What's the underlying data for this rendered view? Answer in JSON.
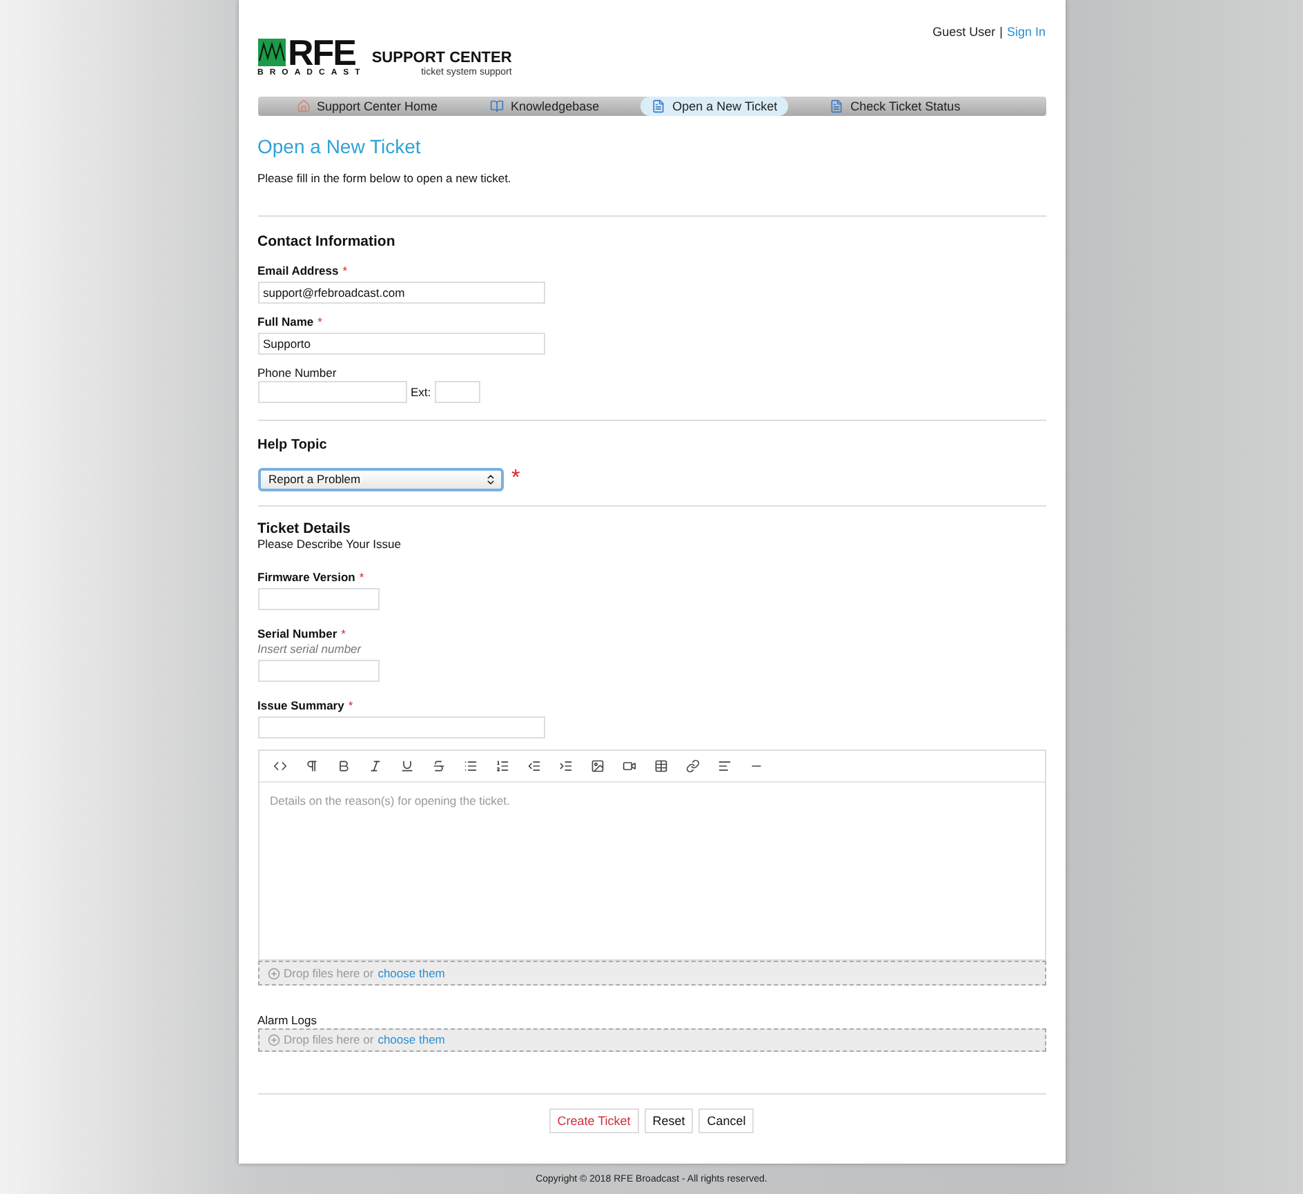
{
  "header": {
    "logo": {
      "letters": "RFE",
      "subline": "BROADCAST",
      "title": "SUPPORT CENTER",
      "tagline": "ticket system support"
    },
    "user": "Guest User",
    "separator": "|",
    "sign_in": "Sign In"
  },
  "nav": [
    {
      "label": "Support Center Home",
      "selected": false
    },
    {
      "label": "Knowledgebase",
      "selected": false
    },
    {
      "label": "Open a New Ticket",
      "selected": true
    },
    {
      "label": "Check Ticket Status",
      "selected": false
    }
  ],
  "page_title": "Open a New Ticket",
  "intro": "Please fill in the form below to open a new ticket.",
  "required_mark": "*",
  "contact": {
    "title": "Contact Information",
    "fields": [
      {
        "label": "Email Address",
        "required": true,
        "value": "support@rfebroadcast.com"
      },
      {
        "label": "Full Name",
        "required": true,
        "value": "Supporto"
      }
    ],
    "phone": {
      "label": "Phone Number",
      "ext_label": "Ext:"
    }
  },
  "help_topic": {
    "label": "Help Topic",
    "value": "Report a Problem",
    "required": true
  },
  "details": {
    "title": "Ticket Details",
    "subtitle": "Please Describe Your Issue",
    "fields": [
      {
        "label": "Firmware Version",
        "required": true,
        "kind": "short"
      },
      {
        "label": "Serial Number",
        "required": true,
        "hint": "Insert serial number",
        "kind": "short"
      },
      {
        "label": "Issue Summary",
        "required": true,
        "kind": "long"
      }
    ],
    "editor_placeholder": "Details on the reason(s) for opening the ticket.",
    "dropzone": {
      "text": "Drop files here or",
      "link": "choose them"
    }
  },
  "alarm_logs": {
    "label": "Alarm Logs",
    "dropzone": {
      "text": "Drop files here or",
      "link": "choose them"
    }
  },
  "buttons": [
    {
      "label": "Create Ticket",
      "kind": "primary"
    },
    {
      "label": "Reset",
      "kind": "plain"
    },
    {
      "label": "Cancel",
      "kind": "plain"
    }
  ],
  "footer": "Copyright © 2018 RFE Broadcast - All rights reserved."
}
